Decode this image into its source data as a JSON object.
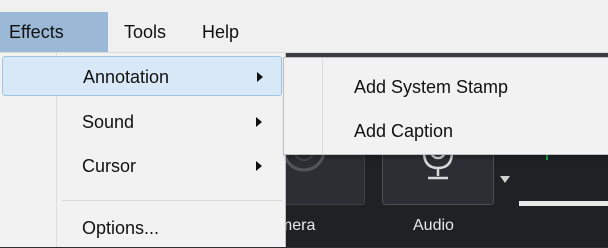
{
  "menubar": {
    "items": [
      {
        "label": "Effects"
      },
      {
        "label": "Tools"
      },
      {
        "label": "Help"
      }
    ]
  },
  "effects_menu": {
    "items": [
      {
        "label": "Annotation",
        "has_submenu": true
      },
      {
        "label": "Sound",
        "has_submenu": true
      },
      {
        "label": "Cursor",
        "has_submenu": true
      },
      {
        "label": "Options...",
        "has_submenu": false
      }
    ]
  },
  "annotation_submenu": {
    "items": [
      {
        "label": "Add System Stamp"
      },
      {
        "label": "Add Caption"
      }
    ]
  },
  "toolbar": {
    "camera_label": "amera",
    "audio_label": "Audio"
  },
  "colors": {
    "menu_active": "#9bb9d6",
    "highlight": "#d8e8f6",
    "app_background": "#1f2124"
  }
}
